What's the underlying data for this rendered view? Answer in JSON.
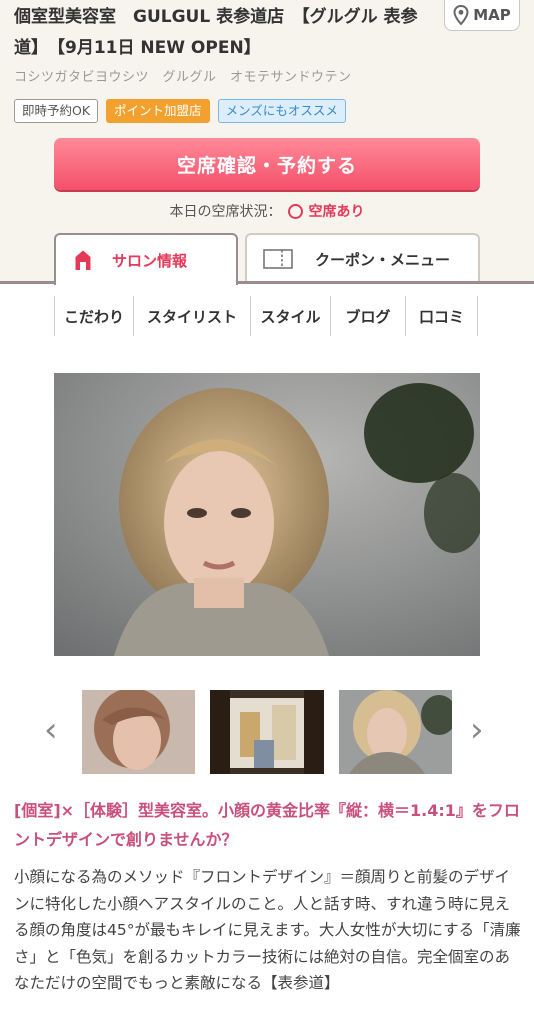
{
  "salon": {
    "name": "個室型美容室　GULGUL 表参道店　【グルグル 表参道】　【9月11日 NEW OPEN】",
    "kana": "コシツガタビヨウシツ　グルグル　オモテサンドウテン"
  },
  "map_button": {
    "label": "MAP",
    "icon": "map-pin-icon"
  },
  "badges": [
    "即時予約OK",
    "ポイント加盟店",
    "メンズにもオススメ"
  ],
  "reserve_button": {
    "label": "空席確認・予約する"
  },
  "vacancy": {
    "label": "本日の空席状況：",
    "status": "空席あり"
  },
  "tabs": [
    {
      "label": "サロン情報",
      "icon": "home-icon",
      "active": true
    },
    {
      "label": "クーポン・メニュー",
      "icon": "book-icon",
      "active": false
    }
  ],
  "subnav": [
    "こだわり",
    "スタイリスト",
    "スタイル",
    "ブログ",
    "口コミ"
  ],
  "carousel": {
    "prev": "‹",
    "next": "›"
  },
  "catch_copy": "[個室]×［体験］型美容室。小顔の黄金比率『縦：横＝1.4:1』をフロントデザインで創りませんか？",
  "description": "小顔になる為のメソッド『フロントデザイン』＝顔周りと前髪のデザインに特化した小顔ヘアスタイルのこと。人と話す時、すれ違う時に見える顔の角度は45°が最もキレイに見えます。大人女性が大切にする「清廉さ」と「色気」を創るカットカラー技術には絶対の自信。完全個室のあなただけの空間でもっと素敵になる【表参道】",
  "colors": {
    "accent": "#e5395a",
    "catch": "#c94f7c",
    "header_bg": "#f6f4ec"
  }
}
